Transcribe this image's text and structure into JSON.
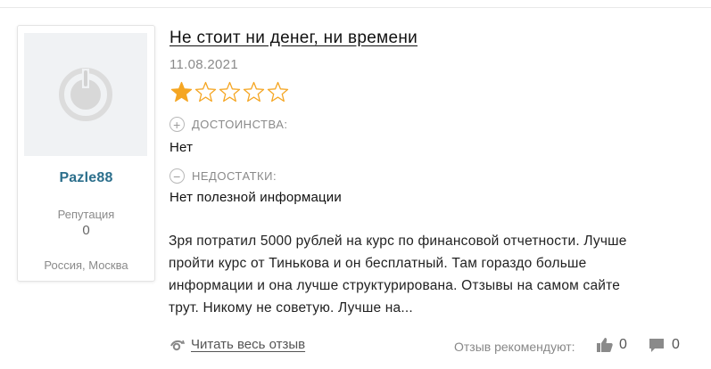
{
  "user": {
    "username": "Pazle88",
    "reputation_label": "Репутация",
    "reputation_value": "0",
    "location": "Россия, Москва"
  },
  "review": {
    "title": "Не стоит ни денег, ни времени",
    "date": "11.08.2021",
    "rating": 1,
    "rating_max": 5,
    "pros_label": "ДОСТОИНСТВА:",
    "pros_value": "Нет",
    "cons_label": "НЕДОСТАТКИ:",
    "cons_value": "Нет полезной информации",
    "body_lines": [
      "Зря потратил 5000 рублей на курс по финансовой отчетности. Лучше",
      "пройти курс от Тинькова и он бесплатный. Там гораздо больше",
      "информации и она лучше структурирована. Отзывы на самом сайте",
      "трут. Никому не советую. Лучше на..."
    ],
    "read_more": "Читать весь отзыв",
    "recommend_label": "Отзыв рекомендуют:",
    "likes": "0",
    "comments": "0"
  },
  "colors": {
    "star_filled": "#f5a623",
    "username": "#2c6f8c"
  },
  "icons": {
    "avatar": "default-avatar-icon",
    "read_more": "eye-icon",
    "likes": "thumbs-up-icon",
    "comments": "comment-icon",
    "pros": "plus-circle-icon",
    "cons": "minus-circle-icon"
  }
}
